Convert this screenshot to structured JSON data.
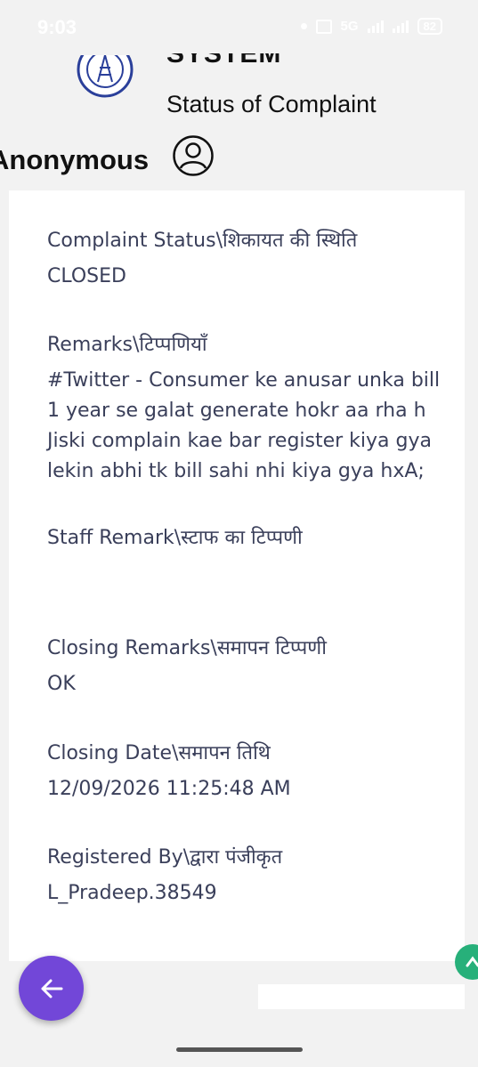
{
  "status_bar": {
    "time": "9:03",
    "network": "5G",
    "battery": "82"
  },
  "header": {
    "system_text": "SYSTEM",
    "title": "Status of Complaint",
    "user_name": "Anonymous"
  },
  "fields": [
    {
      "label": "Complaint Status\\शिकायत की स्थिति",
      "value": "CLOSED"
    },
    {
      "label": "Remarks\\टिप्पणियाँ",
      "value": "#Twitter - Consumer ke anusar unka bill 1 year se galat generate hokr aa rha h Jiski complain kae bar register kiya gya lekin abhi tk bill sahi nhi kiya gya hxA;"
    },
    {
      "label": "Staff Remark\\स्टाफ का टिप्पणी",
      "value": ""
    },
    {
      "label": "Closing Remarks\\समापन टिप्पणी",
      "value": "OK"
    },
    {
      "label": "Closing Date\\समापन तिथि",
      "value": "12/09/2026 11:25:48 AM"
    },
    {
      "label": "Registered By\\द्वारा पंजीकृत",
      "value": "L_Pradeep.38549"
    }
  ],
  "colors": {
    "accent": "#7247d8",
    "text": "#3a3f5a",
    "background": "#f2f2f2",
    "card": "#ffffff"
  }
}
